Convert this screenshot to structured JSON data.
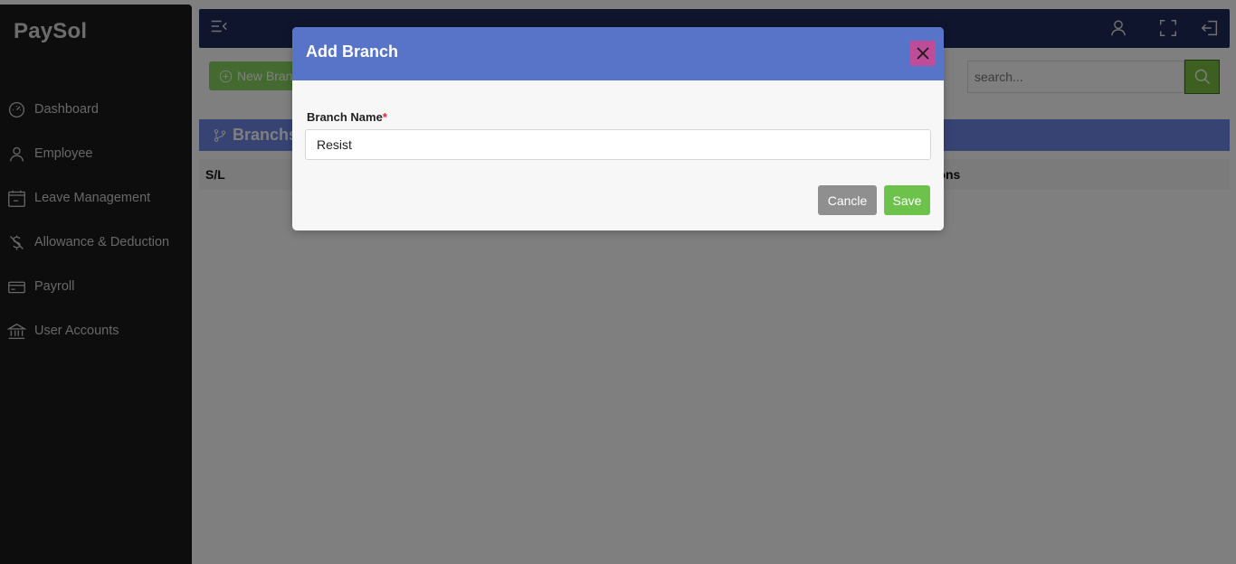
{
  "app": {
    "brand": "PaySol"
  },
  "sidebar": {
    "items": [
      {
        "label": "Dashboard",
        "icon": "dashboard-gauge-icon"
      },
      {
        "label": "Employee",
        "icon": "user-icon"
      },
      {
        "label": "Leave Management",
        "icon": "calendar-icon"
      },
      {
        "label": "Allowance & Deduction",
        "icon": "dollar-off-icon"
      },
      {
        "label": "Payroll",
        "icon": "credit-card-icon"
      },
      {
        "label": "User Accounts",
        "icon": "bank-icon"
      }
    ]
  },
  "toolbar": {
    "menu_icon": "menu-collapse-icon",
    "profile_icon": "user-icon",
    "fullscreen_icon": "fullscreen-icon",
    "logout_icon": "logout-icon"
  },
  "page": {
    "new_button": "New Branch",
    "search_placeholder": "search...",
    "section_title": "Branchs",
    "table_headers": {
      "sl": "S/L",
      "actions": "Actions"
    }
  },
  "modal": {
    "title": "Add Branch",
    "field_label": "Branch Name",
    "required_mark": "*",
    "field_value": "Resist",
    "cancel_label": "Cancle",
    "save_label": "Save"
  },
  "colors": {
    "sidebar_bg": "#1b1b1b",
    "topbar_bg": "#1e2a5a",
    "modal_header": "#5774c8",
    "close_button": "#bf4c98",
    "save_button": "#6cc24a",
    "cancel_button": "#8f8f8f"
  }
}
